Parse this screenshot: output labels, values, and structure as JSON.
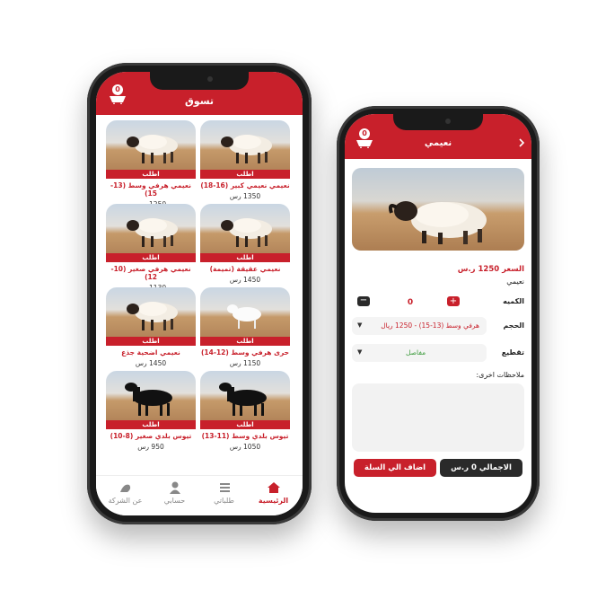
{
  "left": {
    "title": "تسوق",
    "cart_count": "0",
    "products": [
      {
        "order": "اطلب",
        "name": "نعيمي نعيمي كبير (16-18)",
        "price": "1350 رس",
        "kind": "sheep"
      },
      {
        "order": "اطلب",
        "name": "نعيمي هرفي وسط (13-15)",
        "price": "1250 رس",
        "kind": "sheep"
      },
      {
        "order": "اطلب",
        "name": "نعيمي عقيقة (تميمة)",
        "price": "1450 رس",
        "kind": "sheep"
      },
      {
        "order": "اطلب",
        "name": "نعيمي هرفي صغير (10-12)",
        "price": "1130 رس",
        "kind": "sheep"
      },
      {
        "order": "اطلب",
        "name": "حرى هرفي وسط (12-14)",
        "price": "1150 رس",
        "kind": "white-sheep"
      },
      {
        "order": "اطلب",
        "name": "نعيمي اضحية جذع",
        "price": "1450 رس",
        "kind": "sheep"
      },
      {
        "order": "اطلب",
        "name": "تيوس بلدي وسط (11-13)",
        "price": "1050 رس",
        "kind": "goat"
      },
      {
        "order": "اطلب",
        "name": "تيوس بلدي صغير (8-10)",
        "price": "950 رس",
        "kind": "goat"
      }
    ],
    "nav": [
      {
        "label": "الرئيسية",
        "icon": "home-icon",
        "active": true
      },
      {
        "label": "طلباتي",
        "icon": "list-icon",
        "active": false
      },
      {
        "label": "حسابي",
        "icon": "user-icon",
        "active": false
      },
      {
        "label": "عن الشركة",
        "icon": "company-icon",
        "active": false
      }
    ]
  },
  "right": {
    "title": "نعيمي",
    "cart_count": "0",
    "price_label": "السعر 1250 ر.س",
    "category": "نعيمي",
    "quantity_label": "الكميه",
    "quantity_value": "0",
    "size_label": "الحجم",
    "size_value": "هرفي وسط (13-15) - 1250 ريال",
    "cut_label": "تقطيع",
    "cut_value": "مفاصل",
    "notes_label": "ملاحظات اخرى:",
    "total_label": "الاجمالي 0 ر.س",
    "add_label": "اضاف الي السلة"
  },
  "colors": {
    "brand": "#c8202b",
    "green": "#3a9a3a"
  }
}
